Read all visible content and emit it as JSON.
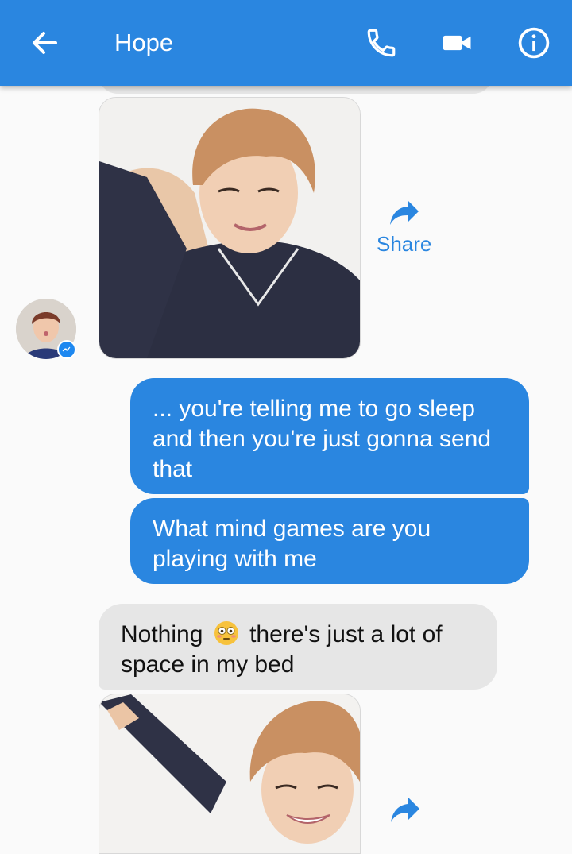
{
  "header": {
    "title": "Hope",
    "back_icon": "arrow-left-icon",
    "call_icon": "phone-icon",
    "video_icon": "video-camera-icon",
    "info_icon": "info-icon",
    "bar_color": "#2a86e0"
  },
  "messages": [
    {
      "type": "image",
      "direction": "incoming",
      "share_label": "Share"
    },
    {
      "type": "text",
      "direction": "outgoing",
      "text": "... you're telling me to go sleep and then you're just gonna send that"
    },
    {
      "type": "text",
      "direction": "outgoing",
      "text": "What mind games are you playing with me"
    },
    {
      "type": "text",
      "direction": "incoming",
      "text_before": "Nothing",
      "emoji": "flushed-face-emoji",
      "text_after": "there's just a lot of space in my bed"
    },
    {
      "type": "image",
      "direction": "incoming"
    }
  ],
  "colors": {
    "outgoing_bubble": "#2a86e0",
    "incoming_bubble": "#e6e6e6",
    "share_text": "#2a86e0"
  }
}
